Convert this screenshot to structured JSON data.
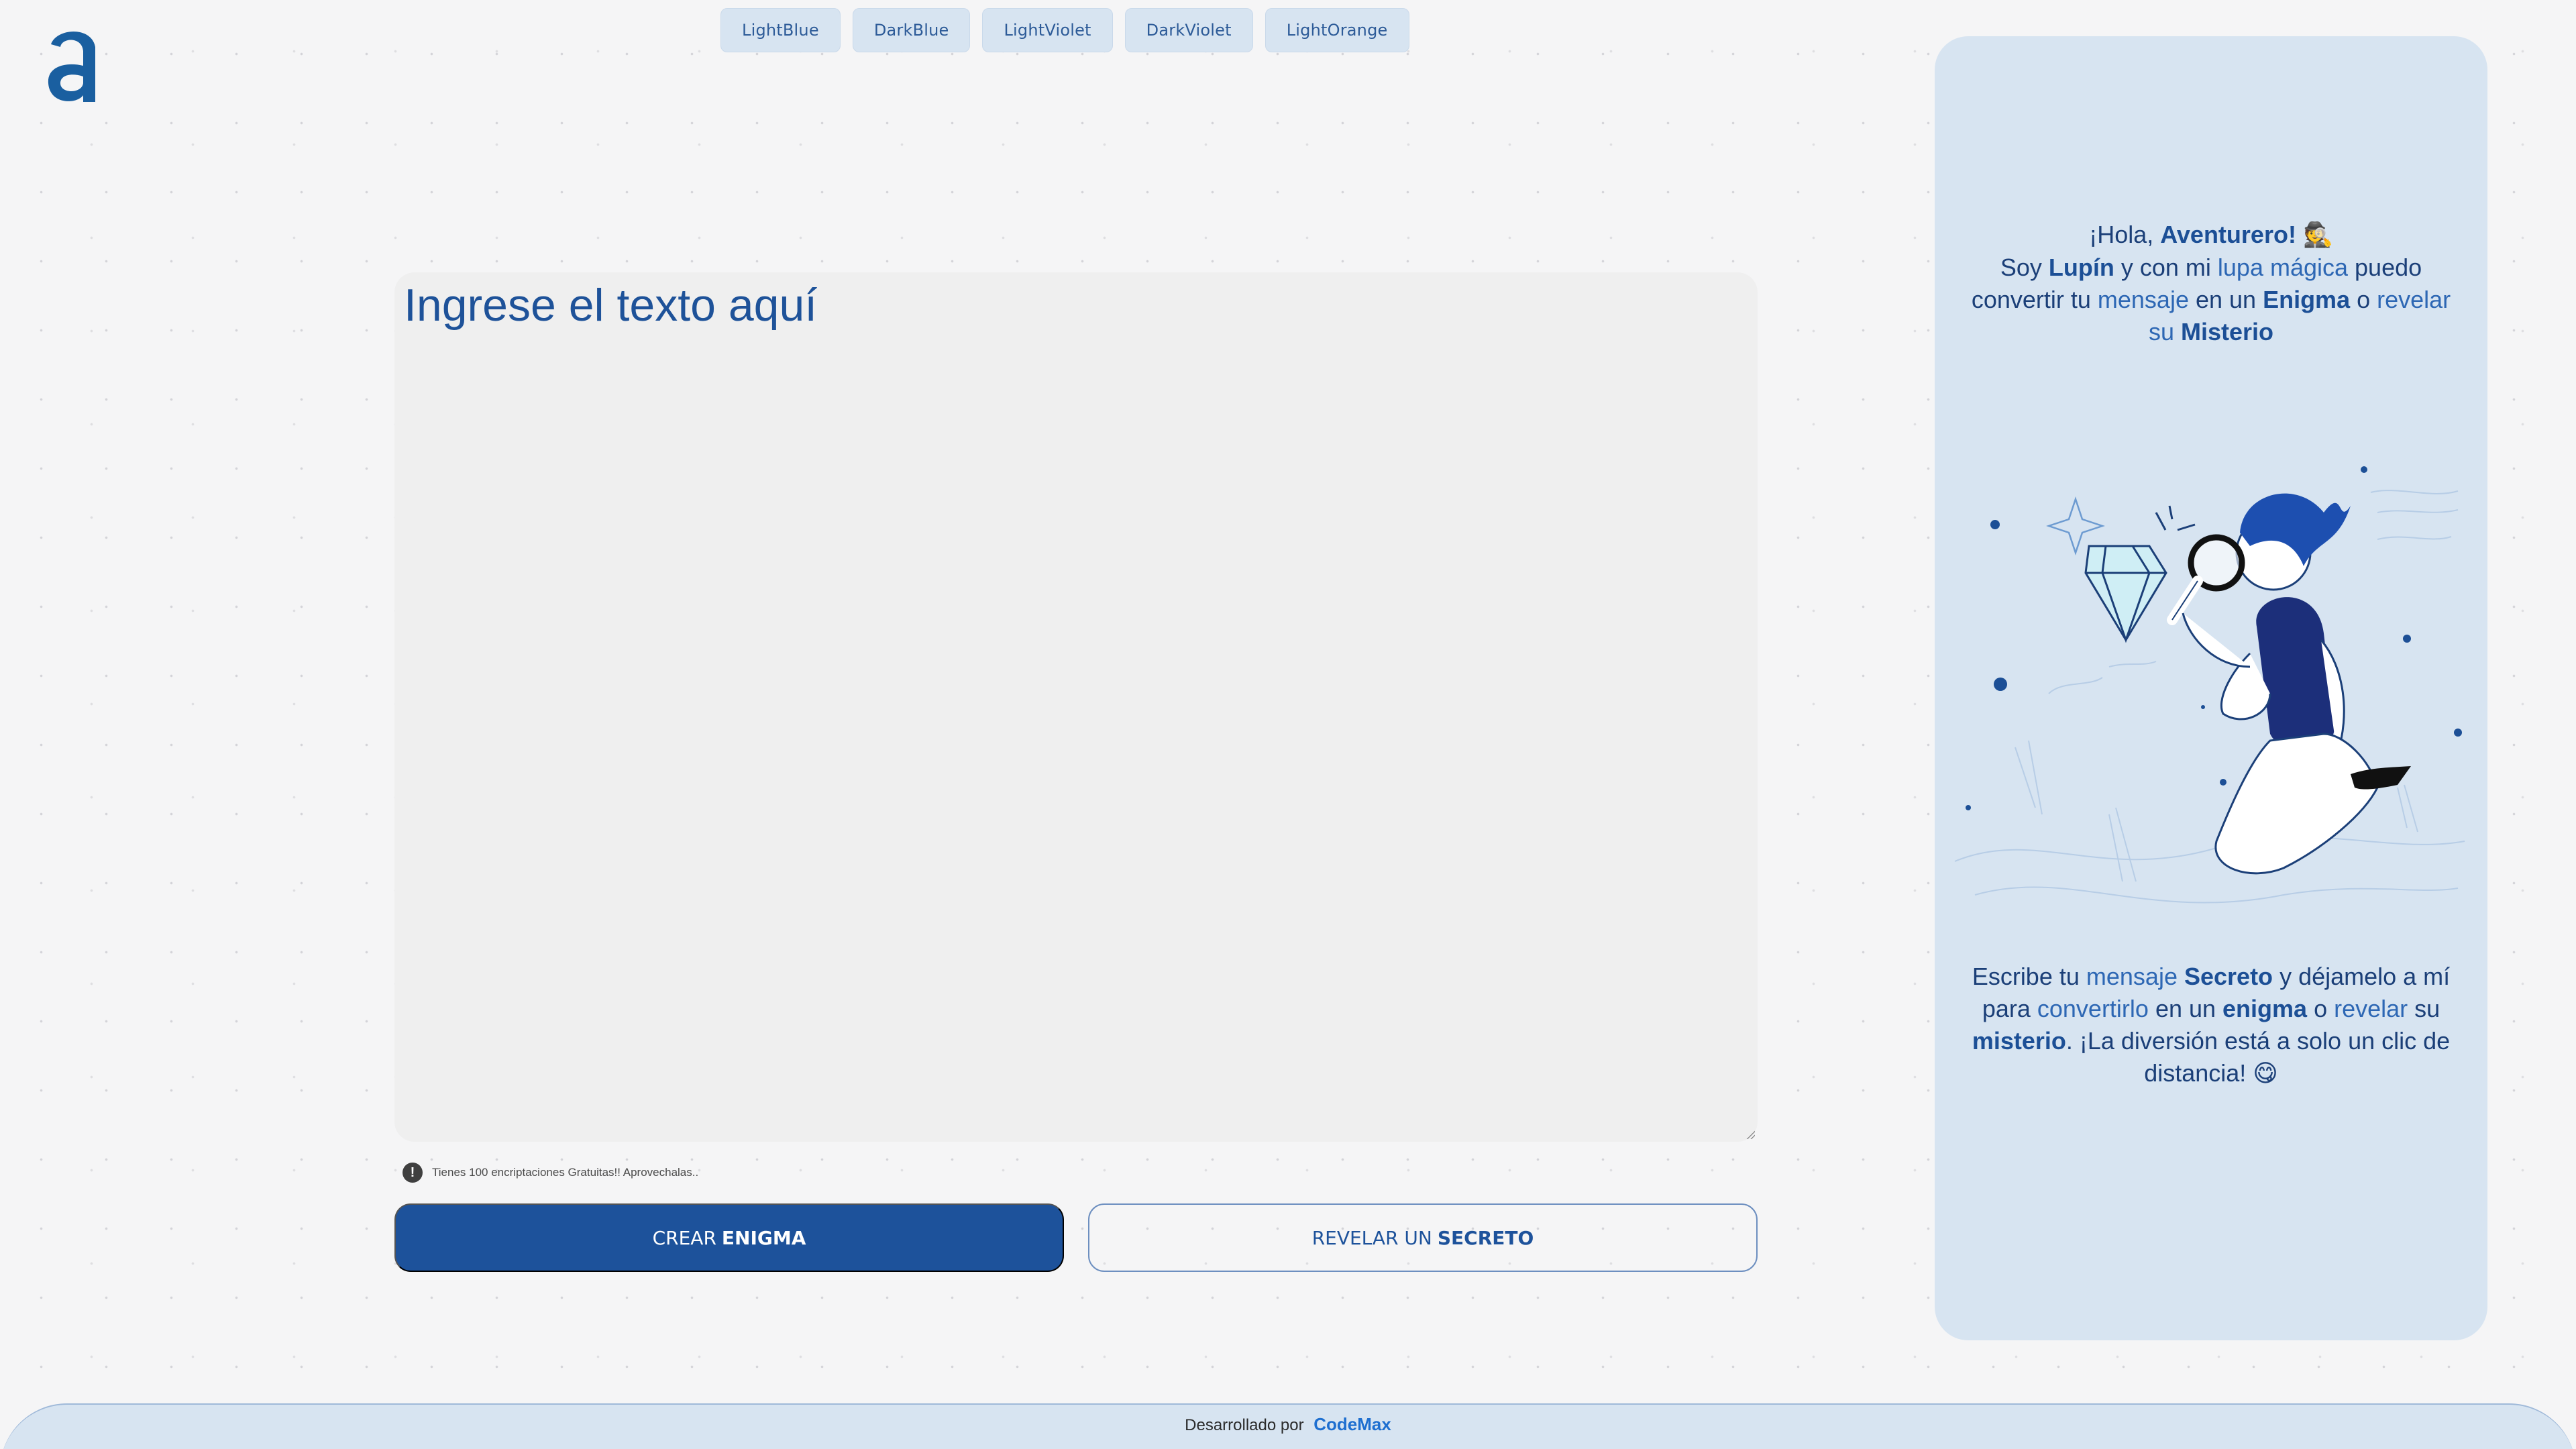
{
  "theme_buttons": [
    {
      "label": "LightBlue"
    },
    {
      "label": "DarkBlue"
    },
    {
      "label": "LightViolet"
    },
    {
      "label": "DarkViolet"
    },
    {
      "label": "LightOrange"
    }
  ],
  "editor": {
    "placeholder": "Ingrese el texto aquí",
    "value": ""
  },
  "info": {
    "icon": "exclamation-icon",
    "text": "Tienes 100 encriptaciones Gratuitas!! Aprovechalas.."
  },
  "actions": {
    "encrypt": {
      "prefix": "CREAR",
      "bold": "ENIGMA"
    },
    "decrypt": {
      "prefix": "REVELAR UN",
      "bold": "SECRETO"
    }
  },
  "panel": {
    "greeting": {
      "hola": "¡Hola, ",
      "aventurero": "Aventurero!",
      "emoji_detective": "🕵",
      "soy": "Soy ",
      "lupin": "Lupín",
      "y_con_mi": " y con mi ",
      "lupa_magica": "lupa mágica",
      "puedo": " puedo convertir tu ",
      "mensaje": "mensaje",
      "en_un": " en un ",
      "enigma": "Enigma",
      "o": " o ",
      "revelar": "revelar",
      "su": " su ",
      "misterio": "Misterio"
    },
    "instructions": {
      "escribe": "Escribe tu ",
      "mensaje": "mensaje",
      "secreto": "Secreto",
      "dejamelo": " y déjamelo a mí para ",
      "convertirlo": "convertirlo",
      "en_un": " en un ",
      "enigma": "enigma",
      "o": " o ",
      "revelar": "revelar",
      "su": " su ",
      "misterio": "misterio",
      "cierre": ". ¡La diversión está a solo un clic de distancia! ",
      "emoji_smile": "😋"
    }
  },
  "footer": {
    "prefix": "Desarrollado por",
    "brand": "CodeMax"
  },
  "colors": {
    "primary": "#1d529b",
    "panel_bg": "#d7e4f1",
    "page_bg": "#f5f5f6",
    "editor_bg": "#efefef"
  }
}
